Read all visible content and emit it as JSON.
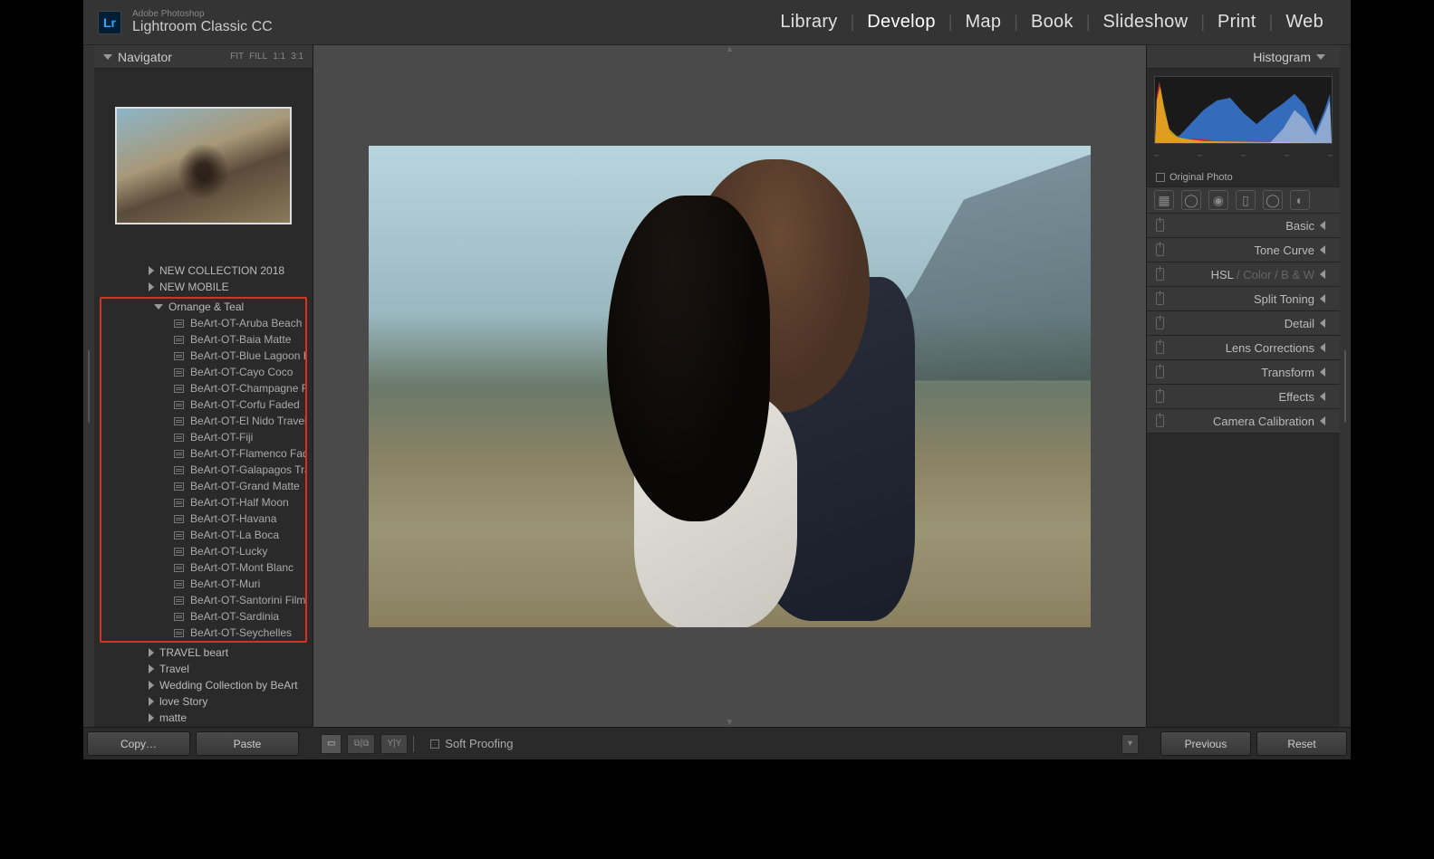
{
  "brand": {
    "small": "Adobe Photoshop",
    "large": "Lightroom Classic CC",
    "logo": "Lr"
  },
  "modules": [
    "Library",
    "Develop",
    "Map",
    "Book",
    "Slideshow",
    "Print",
    "Web"
  ],
  "active_module": "Develop",
  "navigator": {
    "title": "Navigator",
    "zoom": [
      "FIT",
      "FILL",
      "1:1",
      "3:1"
    ]
  },
  "folders_before": [
    "NEW COLLECTION 2018",
    "NEW MOBILE"
  ],
  "highlighted_folder": "Ornange & Teal",
  "presets": [
    "BeArt-OT-Aruba Beach",
    "BeArt-OT-Baia Matte",
    "BeArt-OT-Blue Lagoon HDR",
    "BeArt-OT-Cayo Coco",
    "BeArt-OT-Champagne Fas…",
    "BeArt-OT-Corfu Faded",
    "BeArt-OT-El Nido Travel",
    "BeArt-OT-Fiji",
    "BeArt-OT-Flamenco Faded",
    "BeArt-OT-Galapagos Trave…",
    "BeArt-OT-Grand Matte",
    "BeArt-OT-Half Moon",
    "BeArt-OT-Havana",
    "BeArt-OT-La Boca",
    "BeArt-OT-Lucky",
    "BeArt-OT-Mont Blanc",
    "BeArt-OT-Muri",
    "BeArt-OT-Santorini Film",
    "BeArt-OT-Sardinia",
    "BeArt-OT-Seychelles"
  ],
  "folders_after": [
    "TRAVEL beart",
    "Travel",
    "Wedding Collection by BeArt",
    "love Story",
    "matte"
  ],
  "right": {
    "histogram": "Histogram",
    "original_photo": "Original Photo",
    "panels": [
      "Basic",
      "Tone Curve",
      "HSL  /  Color  /  B & W",
      "Split Toning",
      "Detail",
      "Lens Corrections",
      "Transform",
      "Effects",
      "Camera Calibration"
    ],
    "hsl_index": 2
  },
  "footer": {
    "copy": "Copy…",
    "paste": "Paste",
    "soft_proofing": "Soft Proofing",
    "previous": "Previous",
    "reset": "Reset",
    "views": [
      "▭",
      "⧉",
      "YY",
      "▯"
    ]
  }
}
